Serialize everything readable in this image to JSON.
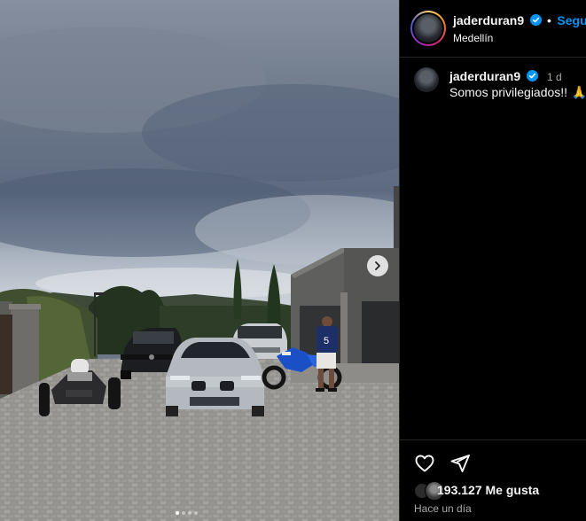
{
  "post": {
    "username": "jaderduran9",
    "follow_label": "Seguir",
    "location": "Medellín",
    "caption_username": "jaderduran9",
    "caption_time": "1 d",
    "caption_text": "Somos privilegiados!!",
    "caption_emoji": "🙏",
    "likes_text": "193.127 Me gusta",
    "posted_ago": "Hace un día"
  },
  "photo": {
    "description_icon": "carousel-photo",
    "jersey_number": "5",
    "carousel_dots": 4,
    "active_dot": 0
  },
  "colors": {
    "accent": "#0095f6",
    "background": "#000000",
    "secondary_text": "#a8a8a8"
  },
  "icons": [
    "verified-badge-icon",
    "next-arrow-icon",
    "heart-icon",
    "share-icon"
  ]
}
